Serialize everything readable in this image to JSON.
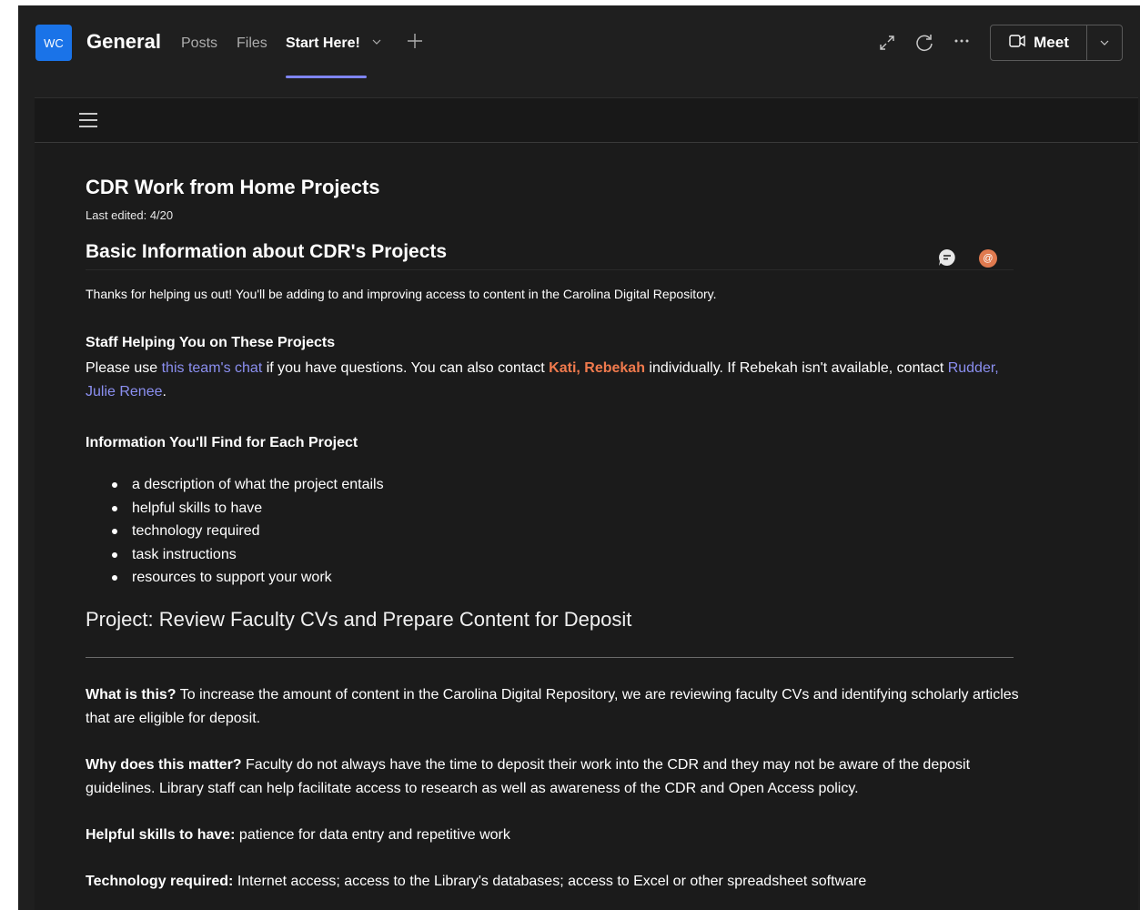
{
  "header": {
    "avatar_initials": "WC",
    "channel_title": "General",
    "tabs": [
      {
        "label": "Posts",
        "active": false
      },
      {
        "label": "Files",
        "active": false
      },
      {
        "label": "Start Here!",
        "active": true
      }
    ],
    "meet_label": "Meet",
    "icons": [
      "expand-icon",
      "refresh-icon",
      "more-icon",
      "video-icon",
      "chevron-down-icon",
      "add-icon"
    ]
  },
  "document": {
    "title": "CDR Work from Home Projects",
    "last_edited": "Last edited: 4/20",
    "section_heading": "Basic Information about CDR's Projects",
    "intro": "Thanks for helping us out! You'll be adding to and improving access to content in the Carolina Digital Repository.",
    "staff_heading": "Staff Helping You on These Projects",
    "staff_text": {
      "part1": "Please use ",
      "chat_link": "this team's chat",
      "part2": " if you have questions. You can also contact ",
      "mention1": "Kati",
      "sep": ", ",
      "mention2": "Rebekah",
      "part3": " individually. If Rebekah isn't available, contact ",
      "contact_link": "Rudder, Julie Renee",
      "part4": "."
    },
    "info_heading": "Information You'll Find for Each Project",
    "info_items": [
      "a description of what the project entails",
      "helpful skills to have",
      "technology required",
      "task instructions",
      "resources to support your work"
    ],
    "project_heading": "Project: Review Faculty CVs and Prepare Content for Deposit",
    "what_label": "What is this?",
    "what_text": " To increase the amount of content in the Carolina Digital Repository, we are reviewing faculty CVs and identifying scholarly articles that are eligible for deposit.",
    "why_label": "Why does this matter?",
    "why_text": " Faculty do not always have the time to deposit their work into the CDR and they may not be aware of the deposit guidelines. Library staff can help facilitate access to research as well as awareness of the CDR and Open Access policy.",
    "skills_label": "Helpful skills to have:",
    "skills_text": " patience for data entry and repetitive work",
    "tech_label": "Technology required:",
    "tech_text": " Internet access; access to the Library's databases; access to Excel or other spreadsheet software"
  },
  "colors": {
    "accent": "#7f85f5",
    "mention": "#f07a4d",
    "link": "#8b8ff0",
    "avatar": "#1a73e8",
    "background": "#1f1f1f"
  }
}
